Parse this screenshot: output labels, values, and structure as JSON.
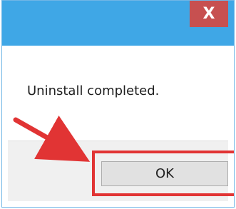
{
  "dialog": {
    "close_button_label": "X",
    "message": "Uninstall completed.",
    "ok_button_label": "OK"
  },
  "colors": {
    "titlebar": "#3fa7e6",
    "close_button": "#c75050",
    "annotation": "#e13434",
    "button_area": "#f0f0f0"
  }
}
